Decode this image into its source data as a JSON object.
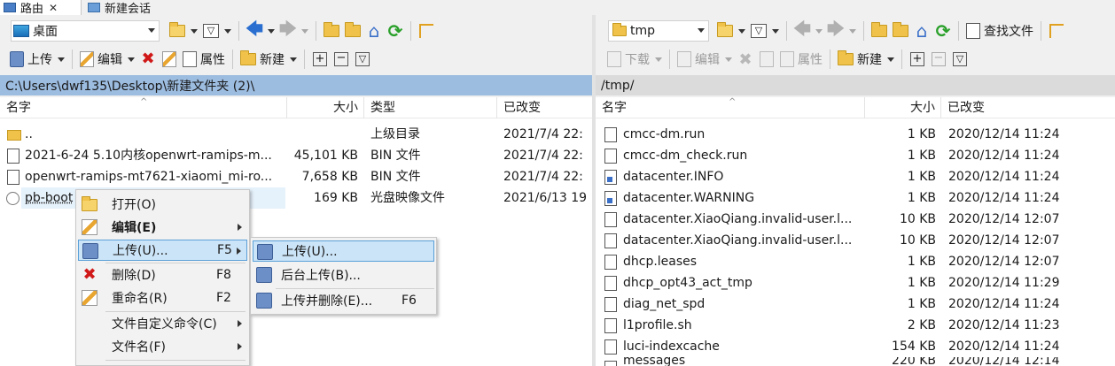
{
  "tabs": [
    {
      "label": "路由",
      "active": true
    },
    {
      "label": "新建会话",
      "active": false
    }
  ],
  "left": {
    "location": "桌面",
    "toolbar2": {
      "upload": "上传",
      "edit": "编辑",
      "properties": "属性",
      "new": "新建"
    },
    "path": "C:\\Users\\dwf135\\Desktop\\新建文件夹 (2)\\",
    "columns": {
      "name": "名字",
      "size": "大小",
      "type": "类型",
      "modified": "已改变"
    },
    "rows": [
      {
        "name": "..",
        "size": "",
        "type": "上级目录",
        "modified": "2021/7/4  22:",
        "icon": "up-folder-icon"
      },
      {
        "name": "2021-6-24 5.10内核openwrt-ramips-m...",
        "size": "45,101 KB",
        "type": "BIN 文件",
        "modified": "2021/7/4  22:",
        "icon": "file-icon"
      },
      {
        "name": "openwrt-ramips-mt7621-xiaomi_mi-ro...",
        "size": "7,658 KB",
        "type": "BIN 文件",
        "modified": "2021/7/4  22:",
        "icon": "file-icon"
      },
      {
        "name": "pb-boot",
        "size": "169 KB",
        "type": "光盘映像文件",
        "modified": "2021/6/13  19",
        "icon": "disc-image-icon"
      }
    ]
  },
  "right": {
    "location": "tmp",
    "find_files": "查找文件",
    "toolbar2": {
      "download": "下载",
      "edit": "编辑",
      "properties": "属性",
      "new": "新建"
    },
    "path": "/tmp/",
    "columns": {
      "name": "名字",
      "size": "大小",
      "modified": "已改变"
    },
    "rows": [
      {
        "name": "cmcc-dm.run",
        "size": "1 KB",
        "modified": "2020/12/14 11:24",
        "icon": "file-icon"
      },
      {
        "name": "cmcc-dm_check.run",
        "size": "1 KB",
        "modified": "2020/12/14 11:24",
        "icon": "file-icon"
      },
      {
        "name": "datacenter.INFO",
        "size": "1 KB",
        "modified": "2020/12/14 11:24",
        "icon": "shortcut-file-icon"
      },
      {
        "name": "datacenter.WARNING",
        "size": "1 KB",
        "modified": "2020/12/14 11:24",
        "icon": "shortcut-file-icon"
      },
      {
        "name": "datacenter.XiaoQiang.invalid-user.l...",
        "size": "10 KB",
        "modified": "2020/12/14 12:07",
        "icon": "file-icon"
      },
      {
        "name": "datacenter.XiaoQiang.invalid-user.l...",
        "size": "10 KB",
        "modified": "2020/12/14 12:07",
        "icon": "file-icon"
      },
      {
        "name": "dhcp.leases",
        "size": "1 KB",
        "modified": "2020/12/14 12:07",
        "icon": "file-icon"
      },
      {
        "name": "dhcp_opt43_act_tmp",
        "size": "1 KB",
        "modified": "2020/12/14 11:29",
        "icon": "file-icon"
      },
      {
        "name": "diag_net_spd",
        "size": "1 KB",
        "modified": "2020/12/14 11:24",
        "icon": "file-icon"
      },
      {
        "name": "l1profile.sh",
        "size": "2 KB",
        "modified": "2020/12/14 11:23",
        "icon": "file-icon"
      },
      {
        "name": "luci-indexcache",
        "size": "154 KB",
        "modified": "2020/12/14 11:24",
        "icon": "file-icon"
      },
      {
        "name": "messages",
        "size": "220 KB",
        "modified": "2020/12/14 12:14",
        "icon": "file-icon"
      }
    ]
  },
  "context_menu": {
    "items": [
      {
        "label": "打开(O)",
        "shortcut": "",
        "submenu": false,
        "bold": false
      },
      {
        "label": "编辑(E)",
        "shortcut": "",
        "submenu": true,
        "bold": true
      },
      {
        "label": "上传(U)...",
        "shortcut": "F5",
        "submenu": true,
        "bold": false,
        "highlighted": true
      },
      {
        "label": "删除(D)",
        "shortcut": "F8",
        "submenu": false,
        "bold": false
      },
      {
        "label": "重命名(R)",
        "shortcut": "F2",
        "submenu": false,
        "bold": false
      },
      {
        "label": "文件自定义命令(C)",
        "shortcut": "",
        "submenu": true,
        "bold": false
      },
      {
        "label": "文件名(F)",
        "shortcut": "",
        "submenu": true,
        "bold": false
      }
    ]
  },
  "upload_submenu": {
    "items": [
      {
        "label": "上传(U)...",
        "shortcut": "",
        "highlighted": true
      },
      {
        "label": "后台上传(B)...",
        "shortcut": ""
      },
      {
        "label": "上传并删除(E)...",
        "shortcut": "F6"
      }
    ]
  },
  "colors": {
    "left_path_bg": "#9cbce0",
    "right_path_bg": "#dbdbdb",
    "selection": "#cce4f7",
    "selection_border": "#5aa0d8"
  }
}
